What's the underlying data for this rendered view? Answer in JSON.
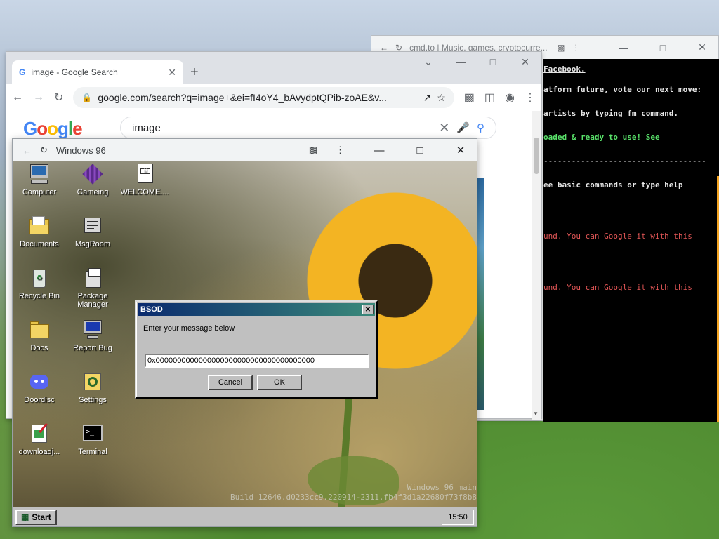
{
  "cmd_browser": {
    "tab_title": "cmd.to | Music, games, cryptocurre...",
    "terminal_lines": [
      {
        "text": "Facebook.",
        "cls": "b u"
      },
      {
        "text": "atform future, vote our next move:",
        "cls": "b"
      },
      {
        "text": "artists by typing fm command.",
        "cls": "b"
      },
      {
        "text": "oaded & ready to use! See",
        "cls": "g"
      },
      {
        "text": "-----------------------------------",
        "cls": ""
      },
      {
        "text": "ee basic commands or type help",
        "cls": "b"
      },
      {
        "text": "und. You can Google it with this",
        "cls": "r"
      },
      {
        "text": "und. You can Google it with this",
        "cls": "r"
      }
    ]
  },
  "chrome": {
    "tab_title": "image - Google Search",
    "url": "google.com/search?q=image+&ei=fI4oY4_bAvydptQPib-zoAE&v...",
    "search_query": "image",
    "logo": [
      "G",
      "o",
      "o",
      "g",
      "l",
      "e"
    ],
    "logo_colors": [
      "#4285f4",
      "#ea4335",
      "#fbbc05",
      "#4285f4",
      "#34a853",
      "#ea4335"
    ]
  },
  "w96_window": {
    "title": "Windows 96"
  },
  "desktop_icons": [
    {
      "label": "Computer",
      "icon": "computer-icon"
    },
    {
      "label": "Gameing",
      "icon": "cube-icon"
    },
    {
      "label": "WELCOME....",
      "icon": "document-icon"
    },
    {
      "label": "Documents",
      "icon": "folder-open-icon"
    },
    {
      "label": "MsgRoom",
      "icon": "chat-icon"
    },
    {
      "label": "Recycle Bin",
      "icon": "recycle-bin-icon"
    },
    {
      "label": "Package Manager",
      "icon": "package-icon"
    },
    {
      "label": "Docs",
      "icon": "folder-icon"
    },
    {
      "label": "Report Bug",
      "icon": "monitor-icon"
    },
    {
      "label": "Doordisc",
      "icon": "discord-icon"
    },
    {
      "label": "Settings",
      "icon": "settings-icon"
    },
    {
      "label": "downloadj...",
      "icon": "download-icon"
    },
    {
      "label": "Terminal",
      "icon": "terminal-icon"
    }
  ],
  "watermark": {
    "line1": "Windows 96 main",
    "line2": "Build 12646.d0233cc9.220914-2311.fb4f3d1a22680f73f8b8"
  },
  "taskbar": {
    "start_label": "Start",
    "clock": "15:50"
  },
  "dialog": {
    "title": "BSOD",
    "close_label": "✕",
    "message": "Enter your message below",
    "input_value": "0x0000000000000000000000000000000000000",
    "cancel_label": "Cancel",
    "ok_label": "OK"
  }
}
